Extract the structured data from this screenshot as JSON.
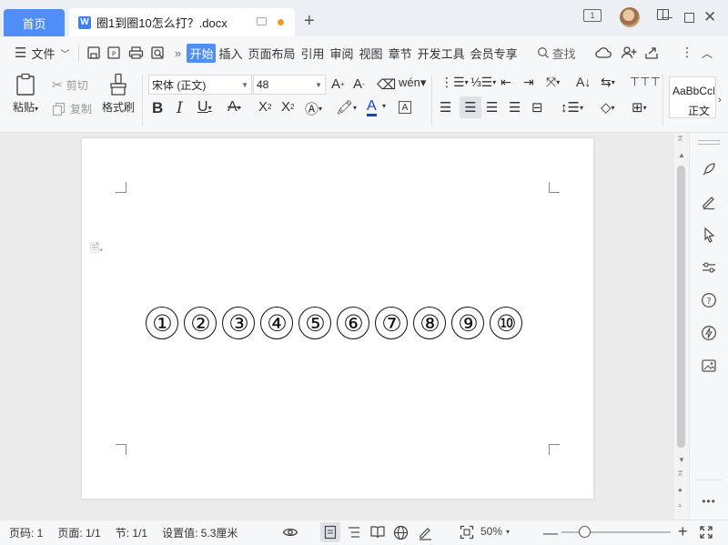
{
  "tabs": {
    "home": "首页",
    "doc_title": "圈1到圈10怎么打？.docx"
  },
  "menu": {
    "file": "文件",
    "tabs": [
      "开始",
      "插入",
      "页面布局",
      "引用",
      "审阅",
      "视图",
      "章节",
      "开发工具",
      "会员专享"
    ],
    "search": "查找"
  },
  "ribbon": {
    "paste": "粘贴",
    "cut": "剪切",
    "copy": "复制",
    "format_painter": "格式刷",
    "font_name": "宋体 (正文)",
    "font_size": "48",
    "style_preview": "AaBbCcI",
    "style_name": "正文"
  },
  "document": {
    "circled_numbers": [
      "①",
      "②",
      "③",
      "④",
      "⑤",
      "⑥",
      "⑦",
      "⑧",
      "⑨",
      "⑩"
    ]
  },
  "status": {
    "page_num": "页码: 1",
    "pages": "页面: 1/1",
    "section": "节: 1/1",
    "setting": "设置值: 5.3厘米",
    "zoom": "50%",
    "zoom_fraction": 0.5
  },
  "colors": {
    "accent": "#4f8ef7",
    "unsaved_dot": "#f39b1f",
    "font_color": "#1a3fd6"
  }
}
